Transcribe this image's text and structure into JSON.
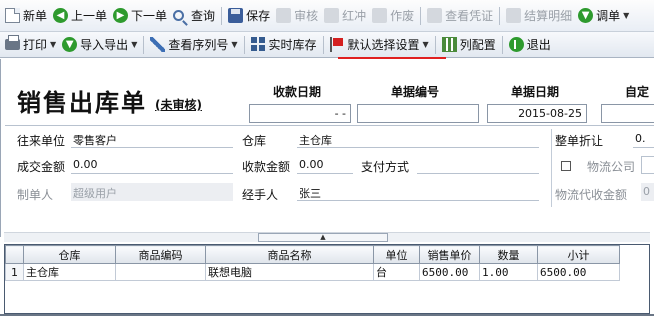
{
  "toolbar1": {
    "new": "新单",
    "prev": "上一单",
    "next": "下一单",
    "query": "查询",
    "save": "保存",
    "audit": "审核",
    "reverse": "红冲",
    "void": "作废",
    "view_voucher": "查看凭证",
    "settle_detail": "结算明细",
    "transfer": "调单"
  },
  "toolbar2": {
    "print": "打印",
    "import_export": "导入导出",
    "view_serial": "查看序列号",
    "realtime_stock": "实时库存",
    "default_settings": "默认选择设置",
    "column_config": "列配置",
    "exit": "退出"
  },
  "form": {
    "title": "销售出库单",
    "status": "(未审核)",
    "receipt_date_label": "收款日期",
    "receipt_date_value": "- -",
    "doc_no_label": "单据编号",
    "doc_no_value": "",
    "doc_date_label": "单据日期",
    "doc_date_value": "2015-08-25",
    "custom_label": "自定",
    "partner_label": "往来单位",
    "partner_value": "零售客户",
    "warehouse_label": "仓库",
    "warehouse_value": "主仓库",
    "discount_label": "整单折让",
    "discount_value": "0.",
    "amount_label": "成交金额",
    "amount_value": "0.00",
    "received_label": "收款金额",
    "received_value": "0.00",
    "pay_method_label": "支付方式",
    "pay_method_value": "",
    "logistics_label": "物流公司",
    "creator_label": "制单人",
    "creator_value": "超级用户",
    "handler_label": "经手人",
    "handler_value": "张三",
    "logistics_cod_label": "物流代收金额",
    "logistics_cod_value": "0"
  },
  "grid": {
    "headers": [
      "",
      "仓库",
      "商品编码",
      "商品名称",
      "单位",
      "销售单价",
      "数量",
      "小计"
    ],
    "rows": [
      [
        "1",
        "主仓库",
        "",
        "联想电脑",
        "台",
        "6500.00",
        "1.00",
        "6500.00"
      ]
    ]
  }
}
